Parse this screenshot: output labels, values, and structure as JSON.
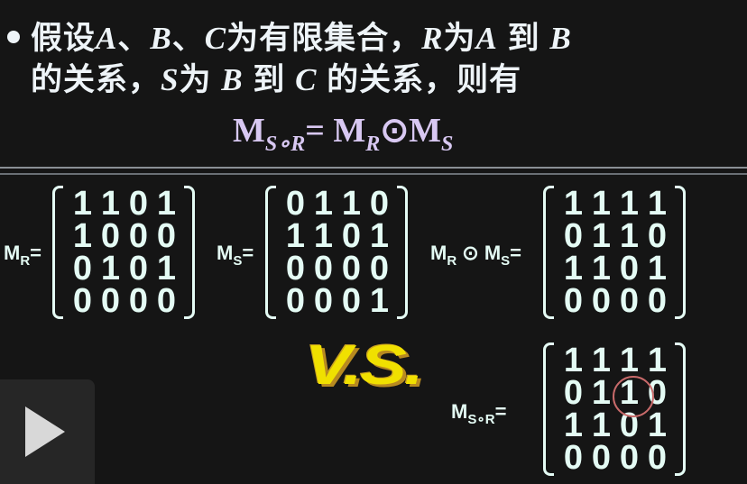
{
  "slide": {
    "line1": [
      "假设",
      "A",
      "、",
      "B",
      "、",
      "C",
      "为有限集合，",
      "R",
      "为",
      "A",
      "到",
      "B"
    ],
    "line2": [
      "的关系，",
      "S",
      "为",
      "B",
      "到",
      "C",
      "的关系，则有"
    ],
    "formula": {
      "m1": "M",
      "s1": "S∘R",
      "eq": "=",
      "m2": "M",
      "s2": "R",
      "op": "⊙",
      "m3": "M",
      "s3": "S"
    },
    "matrices": [
      {
        "label": "M",
        "sub": "R",
        "suffix": "=",
        "rows": [
          [
            "1",
            "1",
            "0",
            "1"
          ],
          [
            "1",
            "0",
            "0",
            "0"
          ],
          [
            "0",
            "1",
            "0",
            "1"
          ],
          [
            "0",
            "0",
            "0",
            "0"
          ]
        ]
      },
      {
        "label": "M",
        "sub": "S",
        "suffix": "=",
        "rows": [
          [
            "0",
            "1",
            "1",
            "0"
          ],
          [
            "1",
            "1",
            "0",
            "1"
          ],
          [
            "0",
            "0",
            "0",
            "0"
          ],
          [
            "0",
            "0",
            "0",
            "1"
          ]
        ]
      },
      {
        "label": "M",
        "sub": "R",
        "op": " ⊙ M",
        "sub2": "S",
        "suffix": "=",
        "rows": [
          [
            "1",
            "1",
            "1",
            "1"
          ],
          [
            "0",
            "1",
            "1",
            "0"
          ],
          [
            "1",
            "1",
            "0",
            "1"
          ],
          [
            "0",
            "0",
            "0",
            "0"
          ]
        ]
      },
      {
        "label": "M",
        "sub": "S∘R",
        "suffix": "=",
        "rows": [
          [
            "1",
            "1",
            "1",
            "1"
          ],
          [
            "0",
            "1",
            "1",
            "0"
          ],
          [
            "1",
            "1",
            "0",
            "1"
          ],
          [
            "0",
            "0",
            "0",
            "0"
          ]
        ],
        "highlight": {
          "row": 2,
          "col": 3,
          "color": "#c86a6a"
        }
      }
    ],
    "vs": "V.S."
  },
  "player": {
    "icon": "play-icon"
  },
  "colors": {
    "background": "#151515",
    "text": "#e4fbf4",
    "formula": "#d8c8f2",
    "vs": "#f0e000",
    "highlight": "#c86a6a"
  }
}
